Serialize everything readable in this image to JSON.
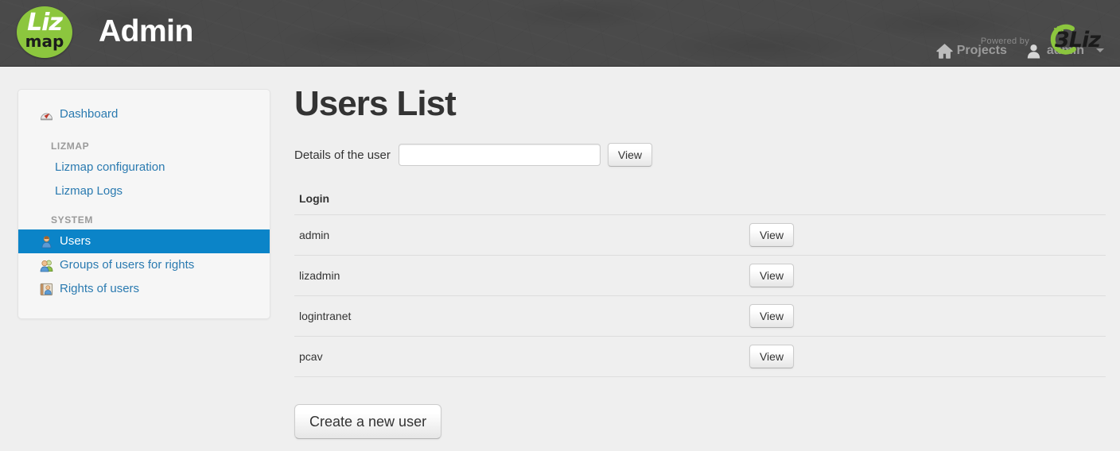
{
  "header": {
    "brand_liz": "Liz",
    "brand_map": "map",
    "title": "Admin",
    "nav": [
      {
        "label": "Projects",
        "icon": "home-icon"
      },
      {
        "label": "admin",
        "icon": "user-icon",
        "caret": true
      }
    ]
  },
  "sidebar": {
    "dashboard": {
      "label": "Dashboard",
      "icon": "dashboard-gauge-icon"
    },
    "sections": [
      {
        "title": "LIZMAP",
        "items": [
          {
            "label": "Lizmap configuration",
            "active": false
          },
          {
            "label": "Lizmap Logs",
            "active": false
          }
        ]
      },
      {
        "title": "SYSTEM",
        "items": [
          {
            "label": "Users",
            "icon": "user-single-icon",
            "active": true
          },
          {
            "label": "Groups of users for rights",
            "icon": "users-group-icon",
            "active": false
          },
          {
            "label": "Rights of users",
            "icon": "user-card-icon",
            "active": false
          }
        ]
      }
    ]
  },
  "main": {
    "title": "Users List",
    "search": {
      "label": "Details of the user",
      "value": "",
      "placeholder": "",
      "button": "View"
    },
    "table": {
      "columns": [
        "Login",
        ""
      ],
      "rows": [
        {
          "login": "admin",
          "action": "View"
        },
        {
          "login": "lizadmin",
          "action": "View"
        },
        {
          "login": "logintranet",
          "action": "View"
        },
        {
          "login": "pcav",
          "action": "View"
        }
      ]
    },
    "create_button": "Create a new user"
  },
  "footer": {
    "powered_by": "Powered by",
    "logo_text": "3Liz"
  },
  "colors": {
    "header_bg": "#4a4a4a",
    "active_item": "#0b84c8",
    "link": "#2a7ab0",
    "brand_green": "#8cc63e",
    "page_bg": "#efefef"
  }
}
